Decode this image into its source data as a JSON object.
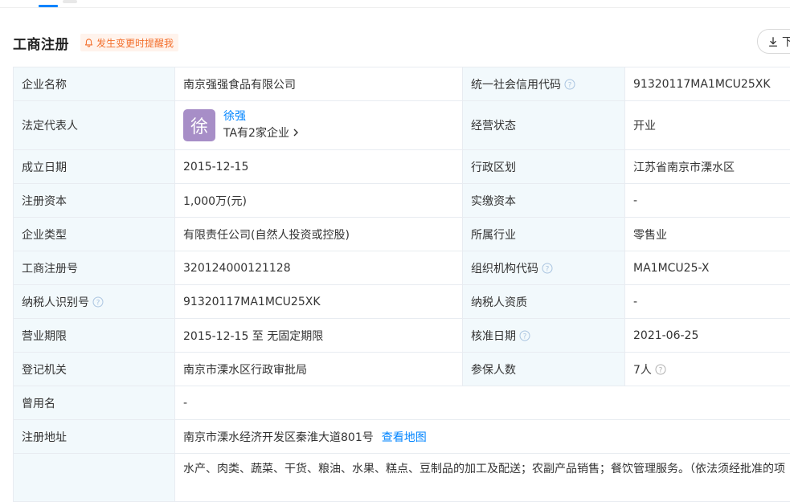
{
  "header": {
    "title": "工商注册",
    "remind_label": "发生变更时提醒我",
    "download_label": "下"
  },
  "rows": {
    "company_name": {
      "label": "企业名称",
      "value": "南京强强食品有限公司"
    },
    "credit_code": {
      "label": "统一社会信用代码",
      "value": "91320117MA1MCU25XK"
    },
    "legal_rep": {
      "label": "法定代表人",
      "avatar_char": "徐",
      "name": "徐强",
      "count_text": "TA有2家企业"
    },
    "status": {
      "label": "经营状态",
      "value": "开业"
    },
    "found_date": {
      "label": "成立日期",
      "value": "2015-12-15"
    },
    "region": {
      "label": "行政区划",
      "value": "江苏省南京市溧水区"
    },
    "reg_capital": {
      "label": "注册资本",
      "value": "1,000万(元)"
    },
    "paid_capital": {
      "label": "实缴资本",
      "value": "-"
    },
    "company_type": {
      "label": "企业类型",
      "value": "有限责任公司(自然人投资或控股)"
    },
    "industry": {
      "label": "所属行业",
      "value": "零售业"
    },
    "reg_number": {
      "label": "工商注册号",
      "value": "320124000121128"
    },
    "org_code": {
      "label": "组织机构代码",
      "value": "MA1MCU25-X"
    },
    "taxpayer_id": {
      "label": "纳税人识别号",
      "value": "91320117MA1MCU25XK"
    },
    "taxpayer_qual": {
      "label": "纳税人资质",
      "value": "-"
    },
    "business_term": {
      "label": "营业期限",
      "value": "2015-12-15 至 无固定期限"
    },
    "approval_date": {
      "label": "核准日期",
      "value": "2021-06-25"
    },
    "authority": {
      "label": "登记机关",
      "value": "南京市溧水区行政审批局"
    },
    "insured": {
      "label": "参保人数",
      "value": "7人"
    },
    "former_name": {
      "label": "曾用名",
      "value": "-"
    },
    "address": {
      "label": "注册地址",
      "value": "南京市溧水经济开发区秦淮大道801号",
      "map_link": "查看地图"
    },
    "scope": {
      "label": "",
      "value": "水产、肉类、蔬菜、干货、粮油、水果、糕点、豆制品的加工及配送；农副产品销售；餐饮管理服务。（依法须经批准的项"
    }
  },
  "colors": {
    "label_bg": "#f2f9fc",
    "link": "#0084ff",
    "remind": "#f36f2c",
    "avatar": "#a78ec7",
    "border": "#e8ecf1"
  }
}
